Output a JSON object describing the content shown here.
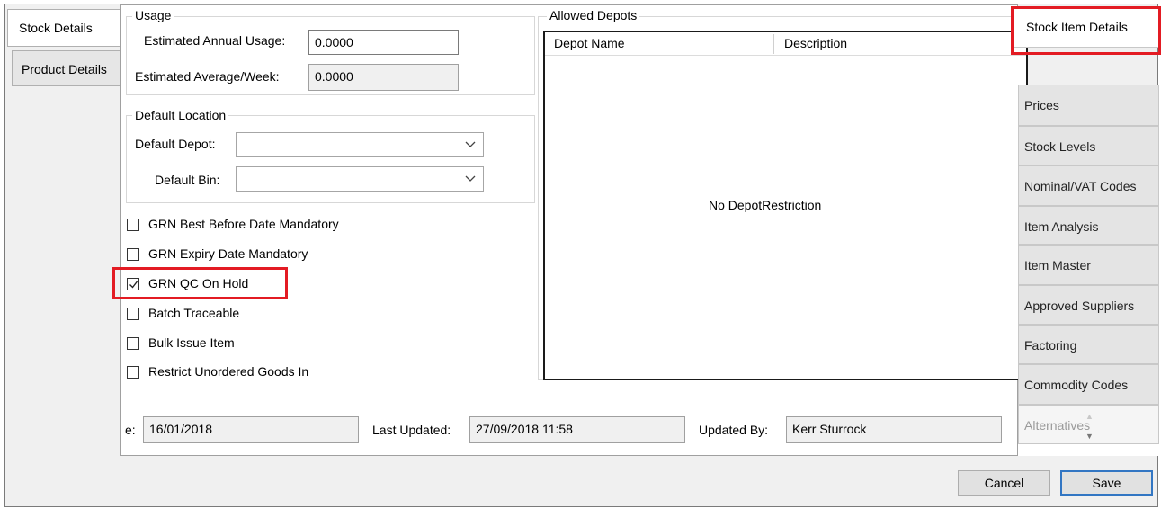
{
  "left_tabs": [
    {
      "label": "Stock Details"
    },
    {
      "label": "Product Details"
    }
  ],
  "usage": {
    "legend": "Usage",
    "annual_label": "Estimated Annual Usage:",
    "annual_value": "0.0000",
    "weekly_label": "Estimated Average/Week:",
    "weekly_value": "0.0000"
  },
  "default_location": {
    "legend": "Default Location",
    "depot_label": "Default Depot:",
    "depot_value": "",
    "bin_label": "Default Bin:",
    "bin_value": ""
  },
  "checkboxes": [
    {
      "label": "GRN Best Before Date Mandatory",
      "checked": false
    },
    {
      "label": "GRN Expiry Date Mandatory",
      "checked": false
    },
    {
      "label": "GRN QC On Hold",
      "checked": true
    },
    {
      "label": "Batch Traceable",
      "checked": false
    },
    {
      "label": "Bulk Issue Item",
      "checked": false
    },
    {
      "label": "Restrict Unordered Goods In",
      "checked": false
    }
  ],
  "allowed_depots": {
    "legend": "Allowed Depots",
    "col_depot": "Depot Name",
    "col_desc": "Description",
    "empty_text": "No DepotRestriction"
  },
  "footer": {
    "created_label_partial": "e:",
    "created_value": "16/01/2018",
    "updated_label": "Last Updated:",
    "updated_value": "27/09/2018 11:58",
    "updated_by_label": "Updated By:",
    "updated_by_value": "Kerr Sturrock"
  },
  "right_tabs": [
    {
      "label": "Stock Item Details",
      "active": true
    },
    {
      "label": "Prices"
    },
    {
      "label": "Stock Levels"
    },
    {
      "label": "Nominal/VAT Codes"
    },
    {
      "label": "Item Analysis"
    },
    {
      "label": "Item Master"
    },
    {
      "label": "Approved Suppliers"
    },
    {
      "label": "Factoring"
    },
    {
      "label": "Commodity  Codes"
    },
    {
      "label": "Alternatives",
      "disabled": true
    }
  ],
  "scroll_icons": {
    "up": "▲",
    "down": "▼"
  },
  "buttons": {
    "cancel": "Cancel",
    "save": "Save"
  },
  "colors": {
    "highlight": "#e31b23",
    "primary_border": "#3276c3"
  }
}
